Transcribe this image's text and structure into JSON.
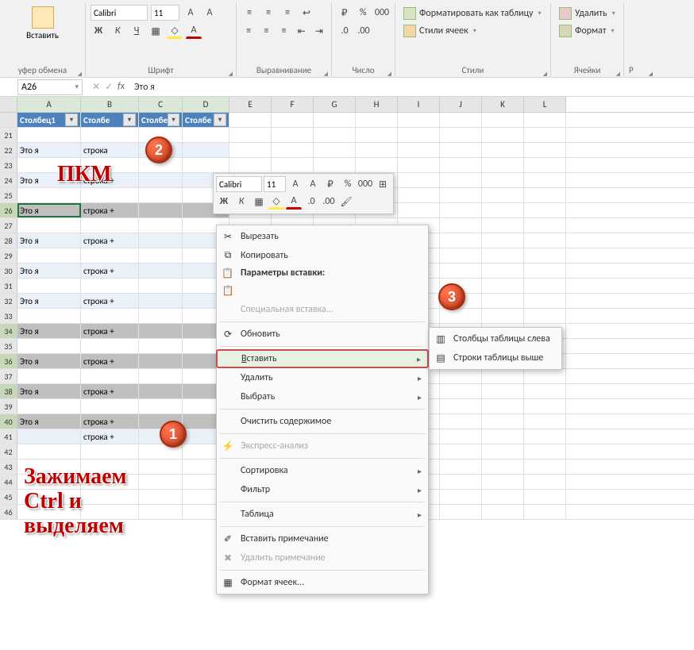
{
  "ribbon": {
    "clipboard": {
      "paste": "Вставить",
      "label": "уфер обмена"
    },
    "font": {
      "name": "Calibri",
      "size": "11",
      "label": "Шрифт",
      "bold": "Ж",
      "italic": "К",
      "underline": "Ч"
    },
    "align": {
      "label": "Выравнивание"
    },
    "number": {
      "label": "Число",
      "pct": "%",
      "thou": "000"
    },
    "styles": {
      "label": "Стили",
      "formatTable": "Форматировать как таблицу",
      "cellStyles": "Стили ячеек"
    },
    "cells": {
      "label": "Ячейки",
      "delete": "Удалить",
      "format": "Формат"
    },
    "edit": {
      "label": "Р"
    }
  },
  "namebox": "A26",
  "formula": "Это я",
  "cols": {
    "data": [
      "Столбец1",
      "Столбе",
      "Столбе",
      "Столбе"
    ],
    "rest": [
      "E",
      "F",
      "G",
      "H",
      "I",
      "J",
      "K",
      "L"
    ]
  },
  "rows": [
    {
      "n": 21,
      "a": "",
      "b": ""
    },
    {
      "n": 22,
      "a": "Это я",
      "b": "строка",
      "d": true
    },
    {
      "n": 23,
      "a": "",
      "b": ""
    },
    {
      "n": 24,
      "a": "Это я",
      "b": "строка +",
      "d": true
    },
    {
      "n": 25,
      "a": "",
      "b": ""
    },
    {
      "n": 26,
      "a": "Это я",
      "b": "строка +",
      "d": true,
      "sel": true,
      "active": true
    },
    {
      "n": 27,
      "a": "",
      "b": ""
    },
    {
      "n": 28,
      "a": "Это я",
      "b": "строка +",
      "d": true
    },
    {
      "n": 29,
      "a": "",
      "b": ""
    },
    {
      "n": 30,
      "a": "Это я",
      "b": "строка +",
      "d": true
    },
    {
      "n": 31,
      "a": "",
      "b": ""
    },
    {
      "n": 32,
      "a": "Это я",
      "b": "строка +",
      "d": true
    },
    {
      "n": 33,
      "a": "",
      "b": ""
    },
    {
      "n": 34,
      "a": "Это я",
      "b": "строка +",
      "d": true,
      "sel": true
    },
    {
      "n": 35,
      "a": "",
      "b": ""
    },
    {
      "n": 36,
      "a": "Это я",
      "b": "строка +",
      "d": true,
      "sel": true
    },
    {
      "n": 37,
      "a": "",
      "b": ""
    },
    {
      "n": 38,
      "a": "Это я",
      "b": "строка +",
      "d": true,
      "sel": true
    },
    {
      "n": 39,
      "a": "",
      "b": ""
    },
    {
      "n": 40,
      "a": "Это я",
      "b": "строка +",
      "d": true,
      "sel": true
    },
    {
      "n": 41,
      "a": "",
      "b": "строка +",
      "d": true
    },
    {
      "n": 42,
      "a": "",
      "b": ""
    },
    {
      "n": 43,
      "a": "",
      "b": ""
    },
    {
      "n": 44,
      "a": "",
      "b": ""
    },
    {
      "n": 45,
      "a": "",
      "b": ""
    },
    {
      "n": 46,
      "a": "",
      "b": ""
    }
  ],
  "mini": {
    "font": "Calibri",
    "size": "11",
    "bold": "Ж",
    "italic": "К",
    "pct": "%",
    "thou": "000"
  },
  "ctx": {
    "cut": "Вырезать",
    "copy": "Копировать",
    "pasteOpt": "Параметры вставки:",
    "pasteSpecial": "Специальная вставка...",
    "refresh": "Обновить",
    "insert": "Вставить",
    "delete": "Удалить",
    "select": "Выбрать",
    "clear": "Очистить содержимое",
    "quick": "Экспресс-анализ",
    "sort": "Сортировка",
    "filter": "Фильтр",
    "table": "Таблица",
    "insComment": "Вставить примечание",
    "delComment": "Удалить примечание",
    "fmtCells": "Формат ячеек..."
  },
  "sub": {
    "colsLeft": "Столбцы таблицы слева",
    "rowsAbove": "Строки таблицы выше"
  },
  "annot": {
    "rmb": "ПКМ",
    "ctrl": "Зажимаем\nCtrl и\nвыделяем"
  },
  "markers": {
    "m1": "1",
    "m2": "2",
    "m3": "3"
  }
}
